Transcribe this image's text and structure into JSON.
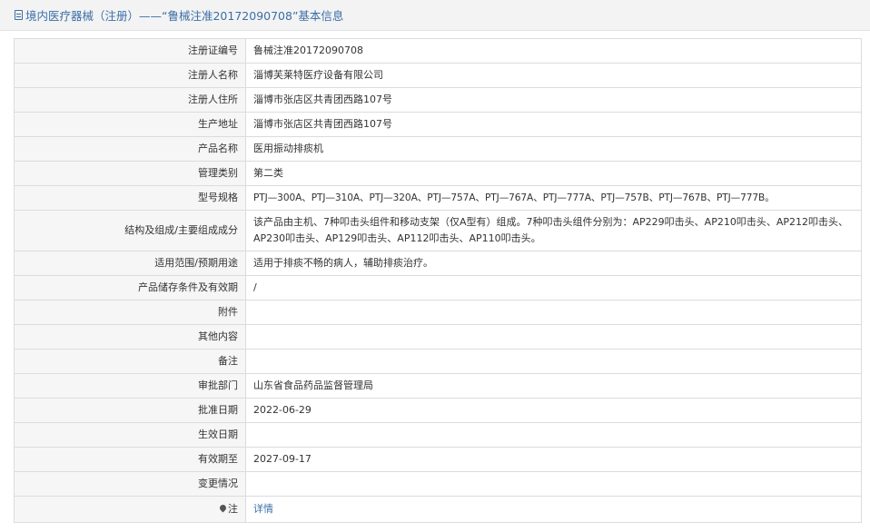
{
  "header": {
    "title": "境内医疗器械（注册）——“鲁械注准20172090708”基本信息"
  },
  "rows": [
    {
      "label": "注册证编号",
      "value": "鲁械注准20172090708"
    },
    {
      "label": "注册人名称",
      "value": "淄博芙莱特医疗设备有限公司"
    },
    {
      "label": "注册人住所",
      "value": "淄博市张店区共青团西路107号"
    },
    {
      "label": "生产地址",
      "value": "淄博市张店区共青团西路107号"
    },
    {
      "label": "产品名称",
      "value": "医用振动排痰机"
    },
    {
      "label": "管理类别",
      "value": "第二类"
    },
    {
      "label": "型号规格",
      "value": "PTJ—300A、PTJ—310A、PTJ—320A、PTJ—757A、PTJ—767A、PTJ—777A、PTJ—757B、PTJ—767B、PTJ—777B。"
    },
    {
      "label": "结构及组成/主要组成成分",
      "value": "该产品由主机、7种叩击头组件和移动支架（仅A型有）组成。7种叩击头组件分别为：AP229叩击头、AP210叩击头、AP212叩击头、AP230叩击头、AP129叩击头、AP112叩击头、AP110叩击头。"
    },
    {
      "label": "适用范围/预期用途",
      "value": "适用于排痰不畅的病人，辅助排痰治疗。"
    },
    {
      "label": "产品储存条件及有效期",
      "value": "/"
    },
    {
      "label": "附件",
      "value": ""
    },
    {
      "label": "其他内容",
      "value": ""
    },
    {
      "label": "备注",
      "value": ""
    },
    {
      "label": "审批部门",
      "value": "山东省食品药品监督管理局"
    },
    {
      "label": "批准日期",
      "value": "2022-06-29"
    },
    {
      "label": "生效日期",
      "value": ""
    },
    {
      "label": "有效期至",
      "value": "2027-09-17"
    },
    {
      "label": "变更情况",
      "value": ""
    }
  ],
  "note": {
    "label": "注",
    "icon": "pin-icon",
    "link_text": "详情"
  }
}
